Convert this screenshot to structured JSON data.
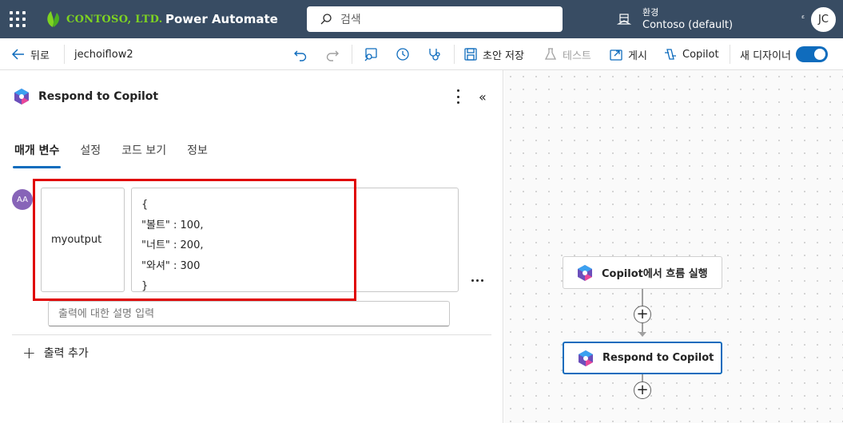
{
  "header": {
    "company": "CONTOSO, LTD.",
    "app_name": "Power Automate",
    "search_placeholder": "검색",
    "env_label": "환경",
    "env_name": "Contoso (default)",
    "settings_glyph": "ᵋ",
    "user_initials": "JC"
  },
  "commandbar": {
    "back": "뒤로",
    "flow_name": "jechoiflow2",
    "save_draft": "초안 저장",
    "test": "테스트",
    "publish": "게시",
    "copilot": "Copilot",
    "new_designer": "새 디자이너",
    "new_designer_on": true
  },
  "panel": {
    "title": "Respond to Copilot",
    "tabs": [
      {
        "label": "매개 변수",
        "active": true
      },
      {
        "label": "설정",
        "active": false
      },
      {
        "label": "코드 보기",
        "active": false
      },
      {
        "label": "정보",
        "active": false
      }
    ],
    "output": {
      "type_badge": "AA",
      "name": "myoutput",
      "value_lines": [
        "{",
        "\"볼트\" : 100,",
        "\"너트\" : 200,",
        "\"와셔\" : 300",
        "}"
      ],
      "description_placeholder": "출력에 대한 설명 입력"
    },
    "add_output": "출력 추가"
  },
  "canvas": {
    "nodes": [
      {
        "label": "Copilot에서 흐름 실행",
        "selected": false
      },
      {
        "label": "Respond to Copilot",
        "selected": true
      }
    ]
  },
  "colors": {
    "header_bg": "#384c63",
    "accent": "#0f6cbd",
    "highlight": "#e00000",
    "logo_green": "#7ed321"
  },
  "icons": [
    "waffle-icon",
    "leaf-logo-icon",
    "search-icon",
    "environment-icon",
    "back-arrow-icon",
    "undo-icon",
    "redo-icon",
    "flow-checker-icon",
    "history-icon",
    "stethoscope-icon",
    "save-icon",
    "flask-icon",
    "publish-icon",
    "copilot-icon",
    "more-vertical-icon",
    "collapse-icon",
    "more-horizontal-icon",
    "plus-icon"
  ]
}
